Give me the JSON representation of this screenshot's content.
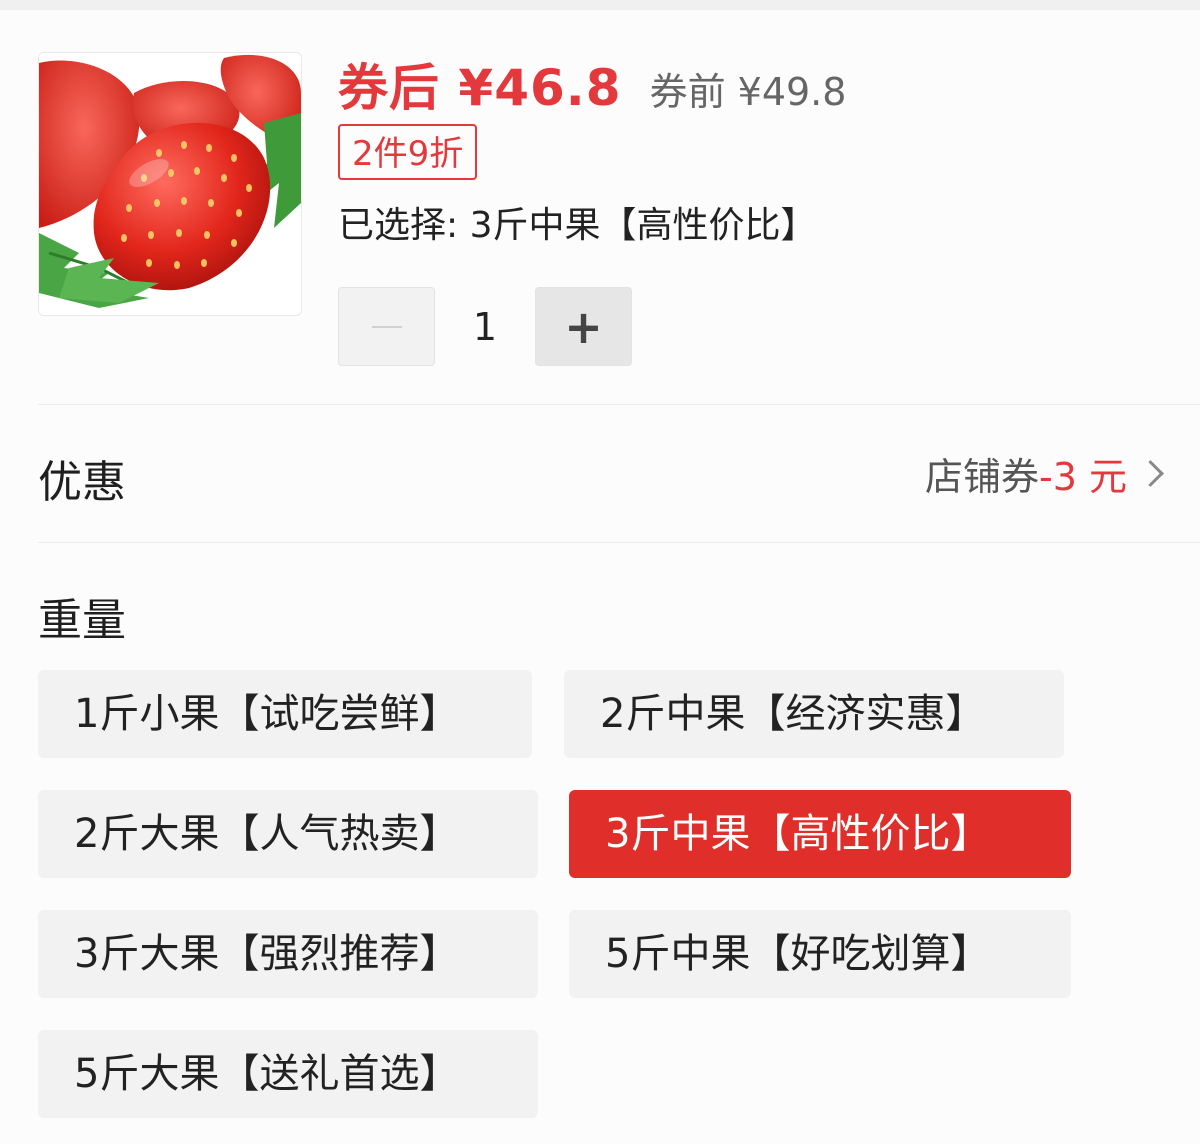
{
  "product": {
    "price_after_label": "券后 ¥46.8",
    "price_before_label": "券前 ¥49.8",
    "discount_badge": "2件9折",
    "selected_label": "已选择: 3斤中果【高性价比】",
    "image_icon": "strawberry-image"
  },
  "quantity": {
    "value": "1",
    "minus_icon": "minus-icon",
    "plus_label": "+"
  },
  "discount_section": {
    "title": "优惠",
    "coupon_prefix": "店铺券",
    "coupon_amount": "-3 元",
    "chevron_icon": "chevron-right-icon"
  },
  "weight_section": {
    "title": "重量",
    "options": [
      {
        "label": "1斤小果【试吃尝鲜】",
        "selected": false
      },
      {
        "label": "2斤中果【经济实惠】",
        "selected": false
      },
      {
        "label": "2斤大果【人气热卖】",
        "selected": false
      },
      {
        "label": "3斤中果【高性价比】",
        "selected": true
      },
      {
        "label": "3斤大果【强烈推荐】",
        "selected": false
      },
      {
        "label": "5斤中果【好吃划算】",
        "selected": false
      },
      {
        "label": "5斤大果【送礼首选】",
        "selected": false
      }
    ]
  },
  "colors": {
    "accent": "#e4393c",
    "selected_bg": "#e02e2a",
    "option_bg": "#f2f2f2"
  }
}
